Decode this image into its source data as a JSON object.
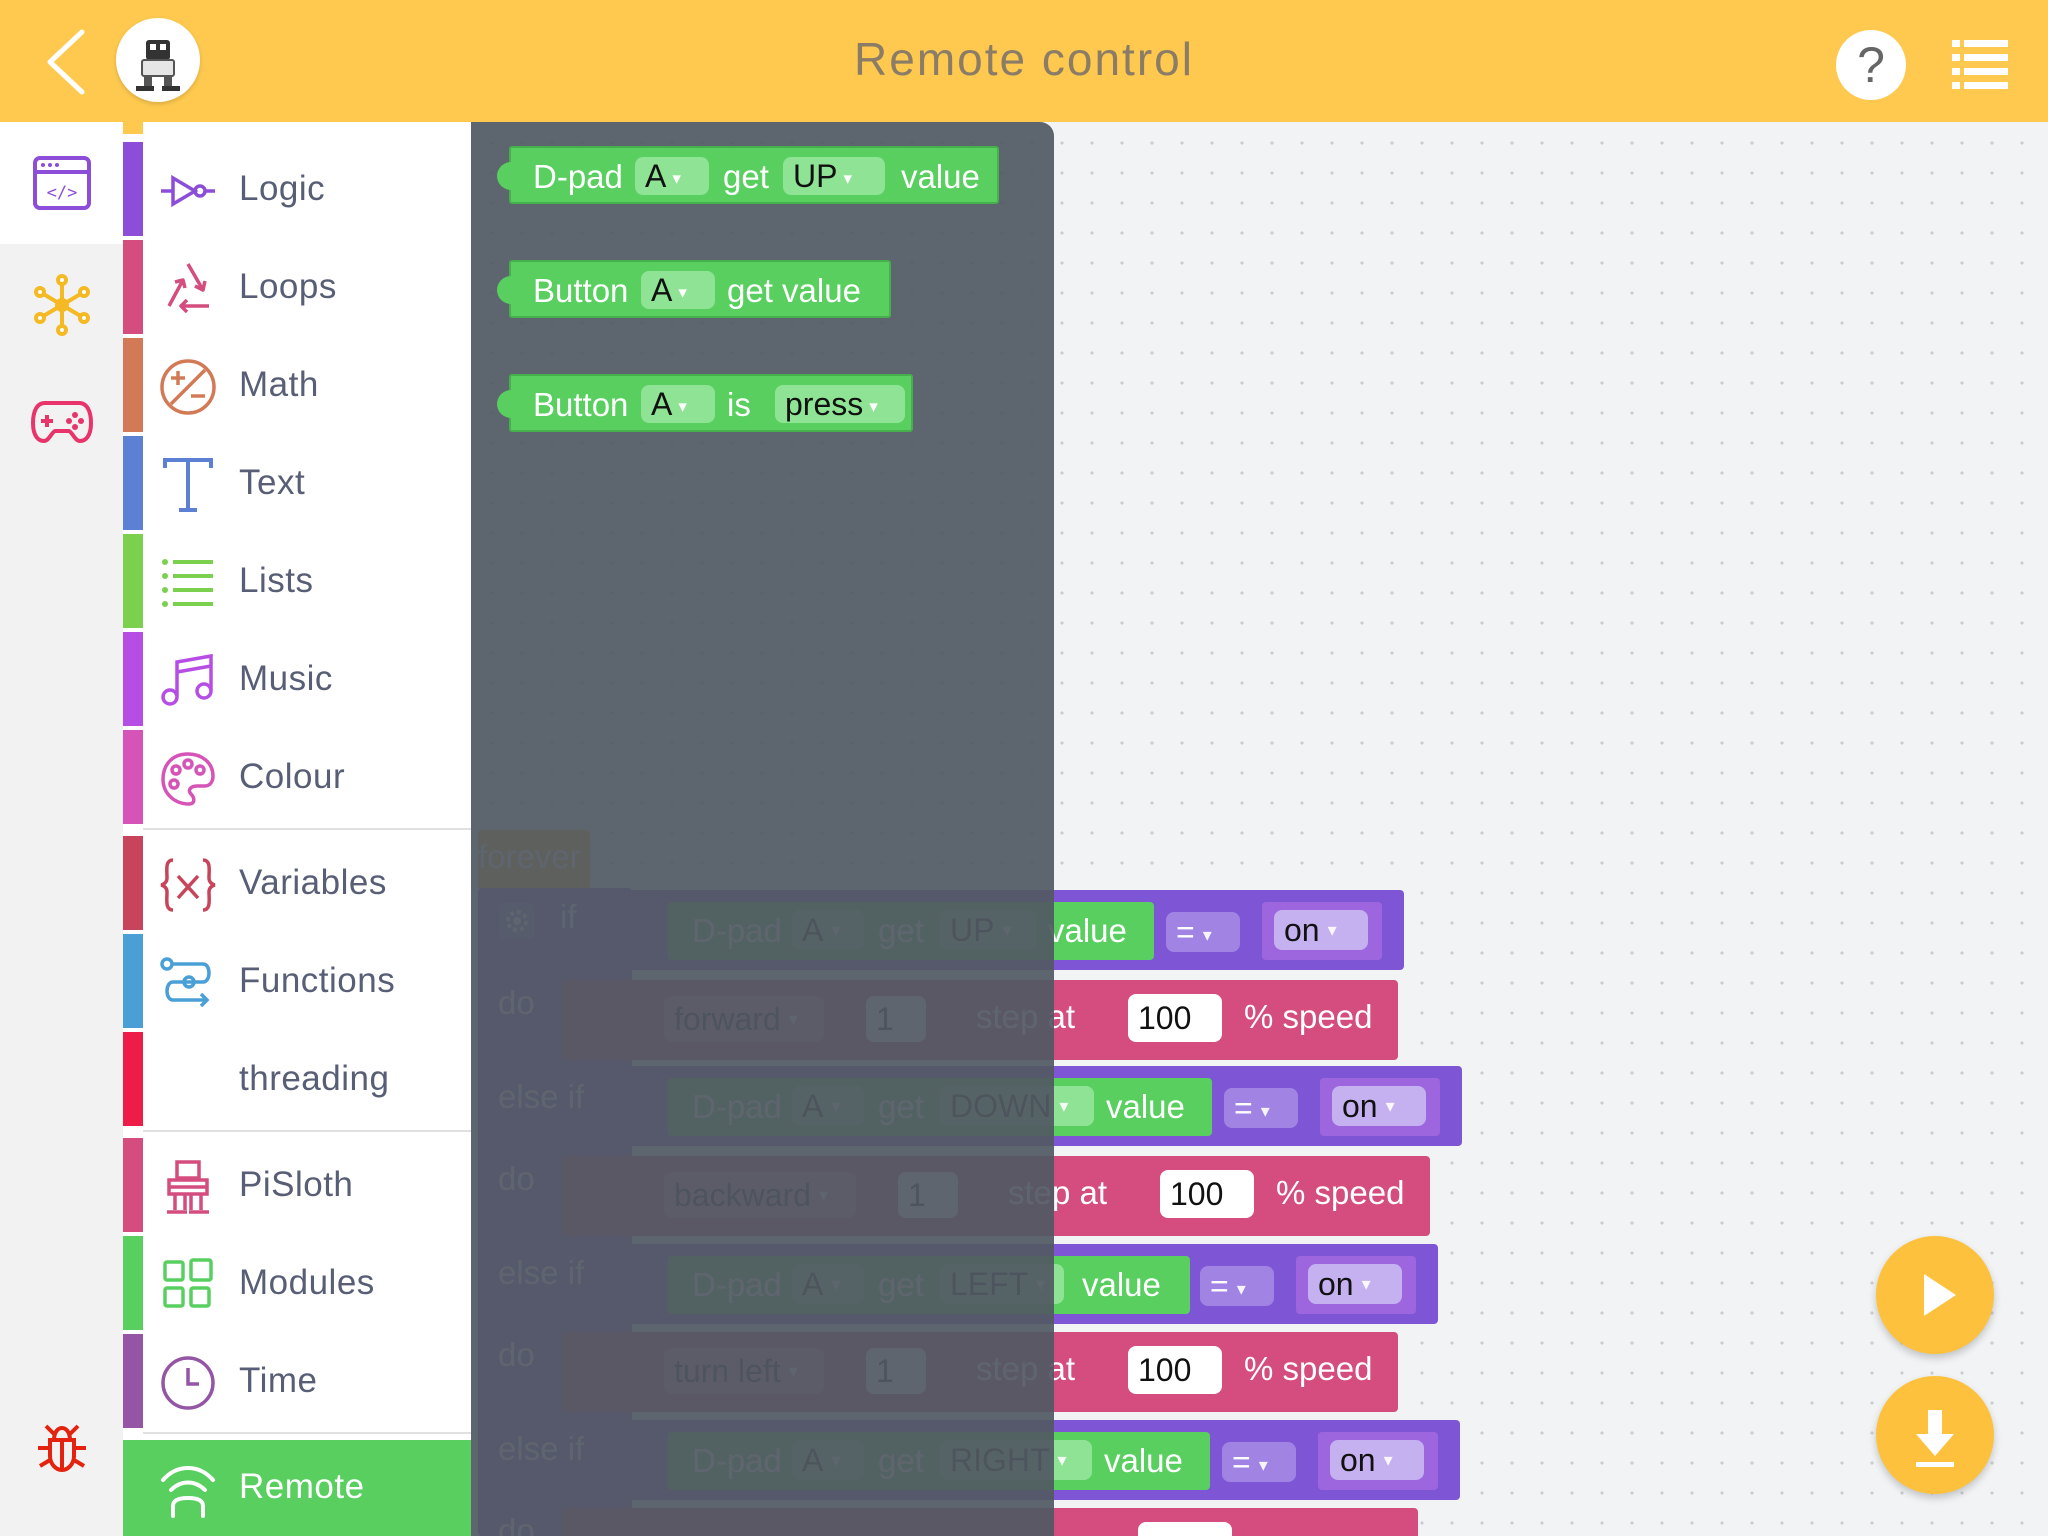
{
  "header": {
    "title": "Remote control",
    "help_label": "?"
  },
  "rail": {
    "items": [
      {
        "name": "code-editor-icon",
        "selected": true
      },
      {
        "name": "connection-icon",
        "selected": false
      },
      {
        "name": "gamepad-icon",
        "selected": false
      },
      {
        "name": "bug-icon",
        "selected": false
      }
    ]
  },
  "categories": [
    {
      "label": "Logic",
      "color": "#8c4ed9"
    },
    {
      "label": "Loops",
      "color": "#d44d7e"
    },
    {
      "label": "Math",
      "color": "#d27a55"
    },
    {
      "label": "Text",
      "color": "#5b80d4"
    },
    {
      "label": "Lists",
      "color": "#7bd14d"
    },
    {
      "label": "Music",
      "color": "#b64ee6"
    },
    {
      "label": "Colour",
      "color": "#d653b8"
    },
    {
      "label": "Variables",
      "color": "#c8445a"
    },
    {
      "label": "Functions",
      "color": "#4aa0d6"
    },
    {
      "label": "threading",
      "color": "#ee1d48"
    },
    {
      "label": "PiSloth",
      "color": "#d44d7e"
    },
    {
      "label": "Modules",
      "color": "#59cf60"
    },
    {
      "label": "Time",
      "color": "#9355a4"
    },
    {
      "label": "Remote",
      "color": "#59cf60"
    }
  ],
  "flyout": {
    "blocks": [
      {
        "parts": [
          "D-pad",
          "A",
          "get",
          "UP",
          "value"
        ]
      },
      {
        "parts": [
          "Button",
          "A",
          "get value"
        ]
      },
      {
        "parts": [
          "Button",
          "A",
          "is",
          "press"
        ]
      }
    ]
  },
  "program": {
    "hat_label": "forever",
    "if_label": "if",
    "do_label": "do",
    "else_if_label": "else if",
    "rows": [
      {
        "dir": "UP",
        "compare": "=",
        "state": "on",
        "action": "forward",
        "steps": "1",
        "speed": "100"
      },
      {
        "dir": "DOWN",
        "compare": "=",
        "state": "on",
        "action": "backward",
        "steps": "1",
        "speed": "100"
      },
      {
        "dir": "LEFT",
        "compare": "=",
        "state": "on",
        "action": "turn left",
        "steps": "1",
        "speed": "100"
      },
      {
        "dir": "RIGHT",
        "compare": "=",
        "state": "on",
        "action": "",
        "steps": "",
        "speed": ""
      }
    ],
    "dpad_label": "D-pad",
    "dpad_id": "A",
    "get_label": "get",
    "value_label": "value",
    "step_at_label": "step at",
    "speed_label": "% speed"
  },
  "fabs": {
    "run": "play-icon",
    "download": "download-icon"
  }
}
